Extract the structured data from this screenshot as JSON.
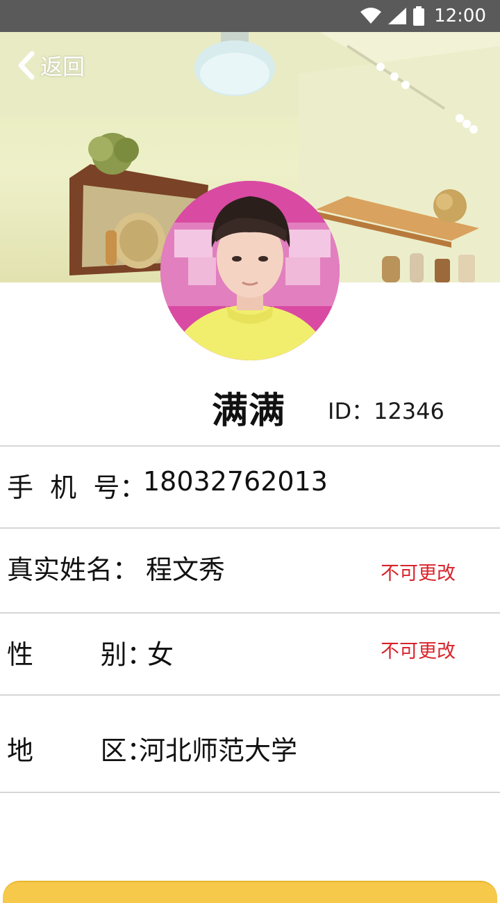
{
  "status_bar": {
    "time": "12:00",
    "icons": [
      "wifi-icon",
      "cellular-signal-icon",
      "battery-icon"
    ]
  },
  "header": {
    "back_label": "返回",
    "back_icon": "chevron-left-icon"
  },
  "profile": {
    "name": "满满",
    "id_text": "ID：12346"
  },
  "fields": {
    "phone": {
      "label": "手  机  号：",
      "value": "18032762013"
    },
    "real_name": {
      "label": "真实姓名：",
      "value": "程文秀",
      "note": "不可更改"
    },
    "gender": {
      "label": "性        别：",
      "value": "女",
      "note": "不可更改"
    },
    "region": {
      "label": "地        区：",
      "value": "河北师范大学"
    }
  },
  "colors": {
    "status_bar": "#5a5a5a",
    "locked_note": "#d8232a",
    "divider": "#d6d6d6",
    "bottom_button": "#f6c94a"
  }
}
